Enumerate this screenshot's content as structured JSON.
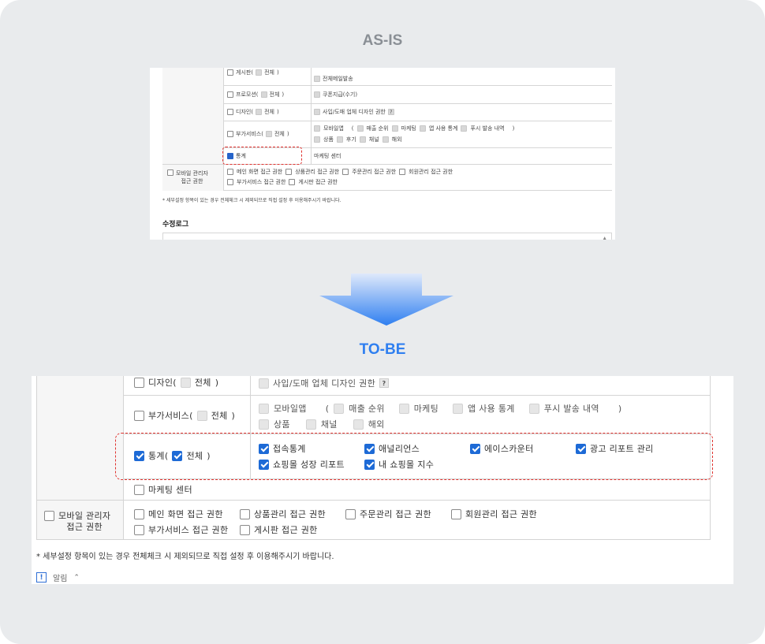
{
  "asis": {
    "title": "AS-IS",
    "rows": [
      {
        "label": "게시판(",
        "all": "전체",
        "close": ")",
        "right": [
          "전체메일발송"
        ]
      },
      {
        "label": "프로모션(",
        "all": "전체",
        "close": ")",
        "right": [
          "쿠폰지급(수기)"
        ]
      },
      {
        "label": "디자인(",
        "all": "전체",
        "close": ")",
        "right": [
          "사입/도매 업체 디자인 권한"
        ],
        "help": "?"
      },
      {
        "label": "부가서비스(",
        "all": "전체",
        "close": ")",
        "line1": [
          "모바일앱",
          "(",
          "매출 순위",
          "마케팅",
          "앱 사용 통계",
          "푸시 발송 내역",
          ")"
        ],
        "line2": [
          "상품",
          "후기",
          "채널",
          "해외"
        ]
      },
      {
        "label": "통계",
        "right": [
          "마케팅 센터"
        ]
      }
    ],
    "mobile_admin": {
      "label_1": "모바일 관리자",
      "label_2": "접근 권한",
      "line1": [
        "메인 화면 접근 권한",
        "상품관리 접근 권한",
        "주문관리 접근 권한",
        "회원관리 접근 권한"
      ],
      "line2": [
        "부가서비스 접근 권한",
        "게시판 접근 권한"
      ]
    },
    "note": "* 세부설정 항목이 있는 경우 전체체크 시 제외되므로 직접 설정 후 이용해주시기 바랍니다.",
    "log_title": "수정로그",
    "scroll_glyph": "▲"
  },
  "tobe": {
    "title": "TO-BE",
    "design": {
      "label": "디자인(",
      "all": "전체",
      "close": ")",
      "right": "사입/도매 업체 디자인 권한",
      "help": "?"
    },
    "addon": {
      "label": "부가서비스(",
      "all": "전체",
      "close": ")",
      "line1": [
        "모바일앱",
        "(",
        "매출 순위",
        "마케팅",
        "앱 사용 통계",
        "푸시 발송 내역",
        ")"
      ],
      "line2": [
        "상품",
        "채널",
        "해외"
      ]
    },
    "stats": {
      "label": "통계(",
      "all": "전체",
      "close": ")",
      "line1": [
        "접속통계",
        "애널리언스",
        "에이스카운터",
        "광고 리포트 관리"
      ],
      "line2": [
        "쇼핑몰 성장 리포트",
        "내 쇼핑몰 지수"
      ]
    },
    "marketing_center": "마케팅 센터",
    "mobile_admin": {
      "label_1": "모바일 관리자",
      "label_2": "접근 권한",
      "line1": [
        "메인 화면 접근 권한",
        "상품관리 접근 권한",
        "주문관리 접근 권한",
        "회원관리 접근 권한"
      ],
      "line2": [
        "부가서비스 접근 권한",
        "게시판 접근 권한"
      ]
    },
    "note": "* 세부설정 항목이 있는 경우 전체체크 시 제외되므로 직접 설정 후 이용해주시기 바랍니다.",
    "notice": {
      "icon": "!",
      "label": "알림",
      "chevron": "⌃"
    }
  },
  "colors": {
    "accent": "#1d6ad6",
    "tobe_title": "#2f7ff0",
    "asis_title": "#8a8f95",
    "highlight": "#e0332f",
    "card": "#e9ebed"
  }
}
